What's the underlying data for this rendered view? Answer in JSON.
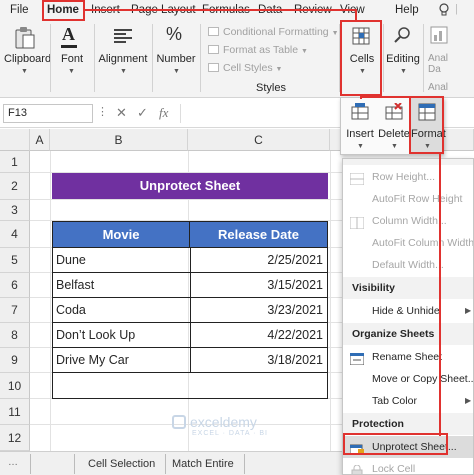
{
  "menu": {
    "tabs": [
      {
        "label": "File"
      },
      {
        "label": "Home"
      },
      {
        "label": "Insert"
      },
      {
        "label": "Page Layout"
      },
      {
        "label": "Formulas"
      },
      {
        "label": "Data"
      },
      {
        "label": "Review"
      },
      {
        "label": "View"
      },
      {
        "label": "Help"
      }
    ]
  },
  "ribbon": {
    "clipboard": "Clipboard",
    "font": "Font",
    "alignment": "Alignment",
    "number": "Number",
    "conditional_formatting": "Conditional Formatting",
    "format_as_table": "Format as Table",
    "cell_styles": "Cell Styles",
    "styles_group": "Styles",
    "cells": "Cells",
    "editing": "Editing",
    "analyze_partial": "Anal Da",
    "analyze_partial2": "Anal"
  },
  "formula_bar": {
    "name_box": "F13",
    "fx": "fx"
  },
  "grid": {
    "columns": [
      "A",
      "B",
      "C"
    ],
    "rows": [
      "1",
      "2",
      "3",
      "4",
      "5",
      "6",
      "7",
      "8",
      "9",
      "10",
      "11",
      "12"
    ],
    "title": "Unprotect Sheet",
    "table_headers": [
      "Movie",
      "Release Date"
    ],
    "table_rows": [
      {
        "movie": "Dune",
        "date": "2/25/2021"
      },
      {
        "movie": "Belfast",
        "date": "3/15/2021"
      },
      {
        "movie": "Coda",
        "date": "3/23/2021"
      },
      {
        "movie": "Don’t Look Up",
        "date": "4/22/2021"
      },
      {
        "movie": "Drive My Car",
        "date": "3/18/2021"
      }
    ]
  },
  "sheet_tabs": [
    "Cell Selection",
    "Match Entire"
  ],
  "watermark": "exceldemy",
  "watermark_sub": "EXCEL · DATA · BI",
  "cells_panel": {
    "insert": "Insert",
    "delete": "Delete",
    "format": "Format"
  },
  "format_menu": {
    "row_height": "Row Height...",
    "autofit_row": "AutoFit Row Height",
    "column_width": "Column Width...",
    "autofit_column": "AutoFit Column Width",
    "default_width": "Default Width...",
    "visibility": "Visibility",
    "hide_unhide": "Hide & Unhide",
    "organize": "Organize Sheets",
    "rename": "Rename Sheet",
    "move_copy": "Move or Copy Sheet...",
    "tab_color": "Tab Color",
    "protection": "Protection",
    "unprotect": "Unprotect Sheet...",
    "lock_cell": "Lock Cell"
  },
  "colors": {
    "title_bg": "#7030a0",
    "header_bg": "#4472c4",
    "annotation": "#e0322f",
    "excel_green": "#217346"
  }
}
